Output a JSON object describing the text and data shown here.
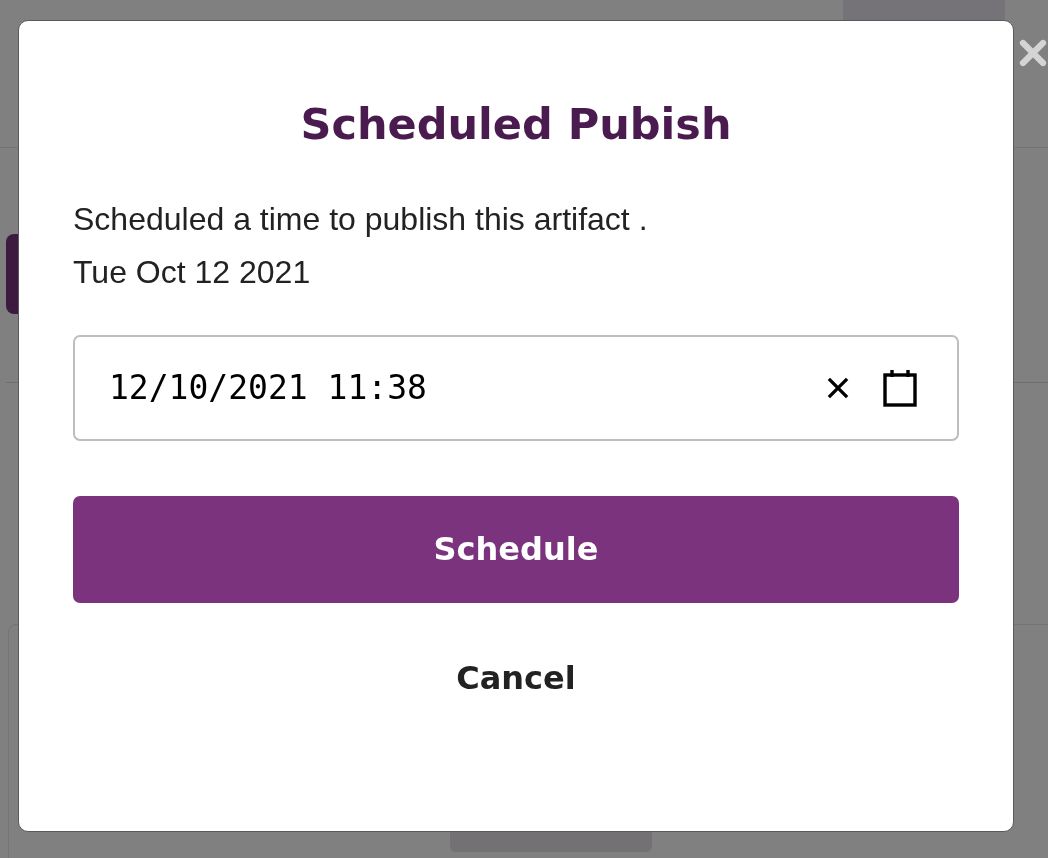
{
  "dialog": {
    "title": "Scheduled Pubish",
    "message": [
      "Scheduled a time to publish this artifact .",
      "Tue Oct 12 2021"
    ],
    "date_field": {
      "value": "12/10/2021 11:38"
    },
    "buttons": [
      {
        "label": "Schedule",
        "kind": "primary"
      },
      {
        "label": "Cancel",
        "kind": "plain"
      }
    ]
  }
}
